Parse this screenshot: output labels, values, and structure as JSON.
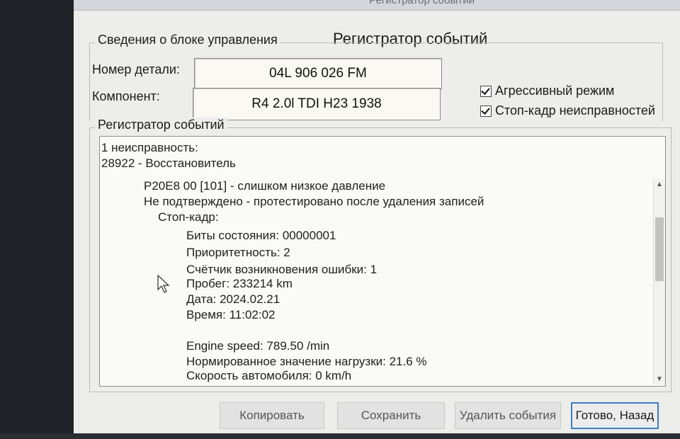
{
  "window": {
    "titlebar_text": "Регистратор событий"
  },
  "dialog": {
    "title": "Регистратор событий"
  },
  "control_unit": {
    "group_label": "Сведения о блоке управления",
    "part_number_label": "Номер детали:",
    "part_number_value": "04L 906 026 FM",
    "component_label": "Компонент:",
    "component_value": "R4 2.0l TDI   H23 1938"
  },
  "options": {
    "aggressive_mode": {
      "label": "Агрессивный режим",
      "checked": true
    },
    "freeze_frame": {
      "label": "Стоп-кадр неисправностей",
      "checked": true
    }
  },
  "event_log": {
    "group_label": "Регистратор событий",
    "lines": [
      "1 неисправность:",
      "28922 - Восстановитель",
      "P20E8 00 [101] - слишком низкое давление",
      "Не подтверждено - протестировано после удаления записей",
      "Стоп-кадр:",
      "Биты состояния: 00000001",
      "Приоритетность: 2",
      "Счётчик возникновения ошибки: 1",
      "Пробег: 233214 km",
      "Дата: 2024.02.21",
      "Время: 11:02:02",
      "Engine speed: 789.50 /min",
      "Нормированное значение нагрузки: 21.6 %",
      "Скорость автомобиля: 0 km/h"
    ]
  },
  "buttons": {
    "copy": "Копировать",
    "save": "Сохранить",
    "delete": "Удалить события",
    "done": "Готово, Назад"
  }
}
